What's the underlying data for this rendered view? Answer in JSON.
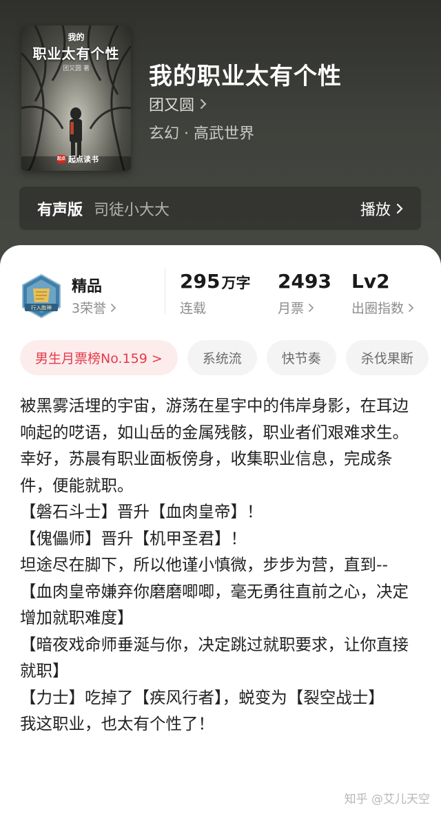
{
  "cover": {
    "small_title": "我的",
    "title": "职业太有个性",
    "author_stamp": "团又圆 著",
    "publisher_logo": "起点",
    "publisher": "起点读书"
  },
  "book": {
    "title": "我的职业太有个性",
    "author": "团又圆",
    "genre": "玄幻 · 高武世界"
  },
  "audio": {
    "label": "有声版",
    "narrator": "司徒小大大",
    "play_label": "播放"
  },
  "stats": {
    "badge_text": "行入胜神",
    "quality_label": "精品",
    "honors": "3荣誉",
    "word_count": "295",
    "word_unit": "万字",
    "status": "连载",
    "monthly_tickets": "2493",
    "monthly_tickets_label": "月票",
    "level": "Lv2",
    "level_label": "出圈指数"
  },
  "tags": [
    "男生月票榜No.159 >",
    "系统流",
    "快节奏",
    "杀伐果断"
  ],
  "description": [
    "被黑雾活埋的宇宙，游荡在星宇中的伟岸身影，在耳边响起的呓语，如山岳的金属残骸，职业者们艰难求生。",
    "幸好，苏晨有职业面板傍身，收集职业信息，完成条件，便能就职。",
    "【磐石斗士】晋升【血肉皇帝】！",
    "【傀儡师】晋升【机甲圣君】！",
    "坦途尽在脚下，所以他谨小慎微，步步为营，直到--",
    "【血肉皇帝嫌弃你磨磨唧唧，毫无勇往直前之心，决定增加就职难度】",
    "【暗夜戏命师垂涎与你，决定跳过就职要求，让你直接就职】",
    "【力士】吃掉了【疾风行者】，蜕变为【裂空战士】",
    "我这职业，也太有个性了！"
  ],
  "watermark": "知乎 @艾儿天空",
  "colors": {
    "hero_bg": "#3f413c",
    "rank_tag_text": "#e4394b",
    "rank_tag_bg": "#fdecec",
    "badge_blue": "#3f7fa8",
    "badge_gold": "#e8c15a"
  }
}
